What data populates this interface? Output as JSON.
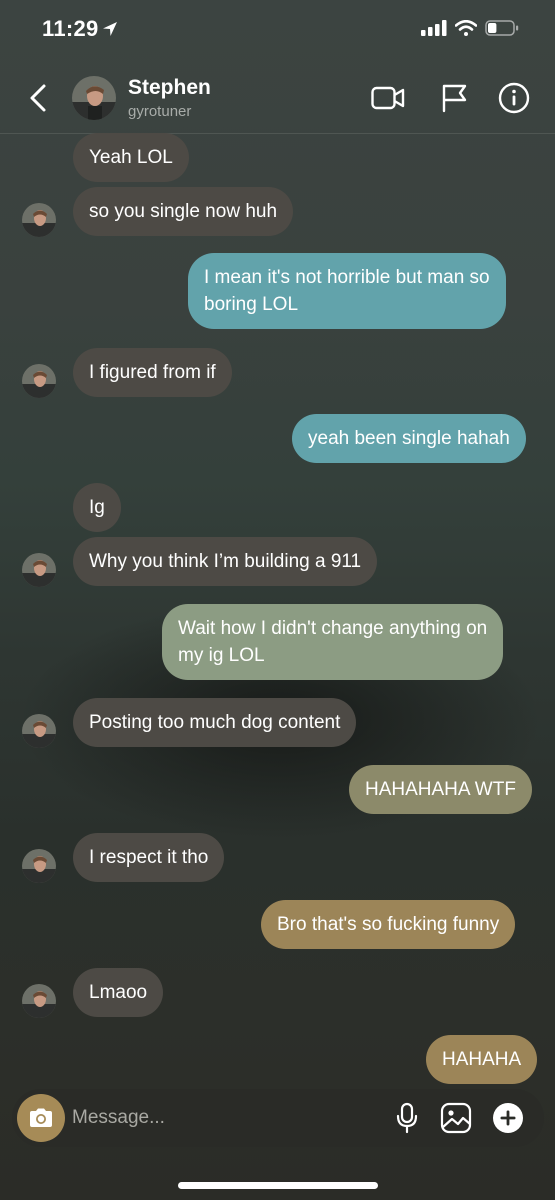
{
  "status_bar": {
    "time": "11:29",
    "battery_level": 0.35
  },
  "header": {
    "name": "Stephen",
    "handle": "gyrotuner",
    "icons": [
      "chevron-left-icon",
      "video-call-icon",
      "flag-icon",
      "info-icon"
    ]
  },
  "messages": [
    {
      "from": "them",
      "text": "Yeah LOL"
    },
    {
      "from": "them",
      "text": "so you single now huh"
    },
    {
      "from": "me",
      "text_lines": [
        "I mean it's not horrible but man so",
        "boring LOL"
      ]
    },
    {
      "from": "them",
      "text": "I figured from if"
    },
    {
      "from": "me",
      "text": "yeah been single hahah"
    },
    {
      "from": "them",
      "text": "Ig"
    },
    {
      "from": "them",
      "text": "Why you think I’m building a 911"
    },
    {
      "from": "me",
      "text_lines": [
        "Wait how I didn't change anything on",
        "my ig LOL"
      ]
    },
    {
      "from": "them",
      "text": "Posting too much dog content"
    },
    {
      "from": "me",
      "text": "HAHAHAHA WTF"
    },
    {
      "from": "them",
      "text": "I respect it tho"
    },
    {
      "from": "me",
      "text": "Bro that's so fucking funny"
    },
    {
      "from": "them",
      "text": "Lmaoo"
    },
    {
      "from": "me",
      "text": "HAHAHA"
    }
  ],
  "composer": {
    "placeholder": "Message...",
    "icons": [
      "camera-icon",
      "microphone-icon",
      "gallery-icon",
      "plus-icon"
    ]
  },
  "colors": {
    "received_bubble": "#4d4a45",
    "sent_teal": "#62a3ab",
    "sent_green": "#8c9c83",
    "sent_olive": "#8c8a6a",
    "sent_gold": "#9c8558",
    "camera_button": "#a68b57"
  }
}
